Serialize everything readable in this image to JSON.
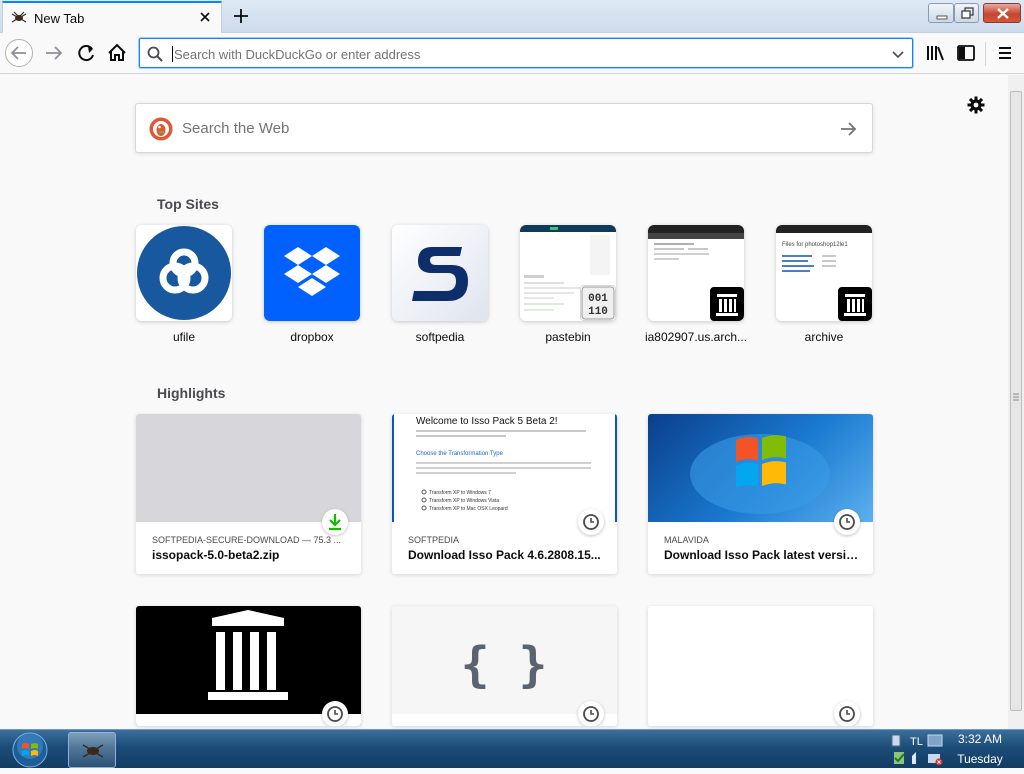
{
  "browser": {
    "tab_title": "New Tab",
    "url_placeholder": "Search with DuckDuckGo or enter address"
  },
  "newtab": {
    "search_placeholder": "Search the Web",
    "top_sites_title": "Top Sites",
    "highlights_title": "Highlights",
    "top_sites": [
      {
        "label": "ufile"
      },
      {
        "label": "dropbox"
      },
      {
        "label": "softpedia"
      },
      {
        "label": "pastebin"
      },
      {
        "label": "ia802907.us.arch..."
      },
      {
        "label": "archive"
      }
    ],
    "highlights": [
      {
        "context": "SOFTPEDIA-SECURE-DOWNLOAD — 75.3 ...",
        "title": "issopack-5.0-beta2.zip",
        "type_icon": "download-icon"
      },
      {
        "context": "SOFTPEDIA",
        "title": "Download Isso Pack 4.6.2808.15...",
        "type_icon": "clock-icon"
      },
      {
        "context": "MALAVIDA",
        "title": "Download Isso Pack latest versio...",
        "type_icon": "clock-icon"
      }
    ],
    "preview_texts": {
      "isso_heading": "Welcome to Isso Pack 5 Beta 2!",
      "isso_subheading": "Choose the Transformation Type",
      "isso_options": [
        "Transform XP to Windows 7",
        "Transform XP to Windows Vista",
        "Transform XP to Mac OSX Leopard"
      ],
      "archive_heading": "Files for photoshop12le1",
      "code_braces": "{ }",
      "badge_digits_top": "001",
      "badge_digits_bottom": "110"
    }
  },
  "taskbar": {
    "time": "3:32 AM",
    "day": "Tuesday"
  },
  "colors": {
    "accent": "#0a84ff",
    "dropbox_blue": "#0061fe",
    "ufile_blue": "#17589e",
    "softpedia_navy": "#0d2d6b",
    "win_close_red": "#c7452f",
    "download_green": "#12bc00"
  }
}
